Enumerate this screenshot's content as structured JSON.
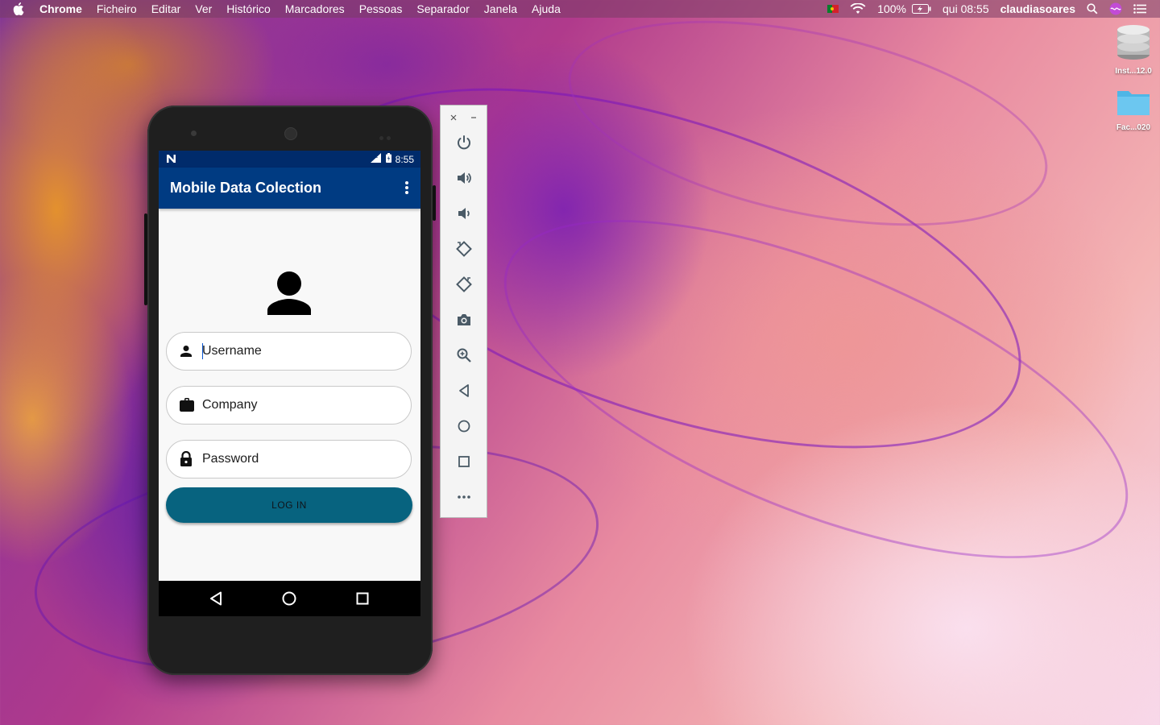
{
  "menubar": {
    "items": [
      "Chrome",
      "Ficheiro",
      "Editar",
      "Ver",
      "Histórico",
      "Marcadores",
      "Pessoas",
      "Separador",
      "Janela",
      "Ajuda"
    ],
    "battery": "100%",
    "clock": "qui 08:55",
    "user": "claudiasoares"
  },
  "desktop": {
    "icons": [
      {
        "label": "Inst...12.0",
        "icon": "disk-icon"
      },
      {
        "label": "Fac...020",
        "icon": "folder-icon"
      }
    ]
  },
  "phone": {
    "statusbar": {
      "time": "8:55"
    },
    "app_title": "Mobile Data Colection",
    "fields": {
      "username_placeholder": "Username",
      "company_placeholder": "Company",
      "password_placeholder": "Password"
    },
    "login_label": "LOG IN"
  },
  "emulator_toolbar": {
    "tools": [
      "power-icon",
      "volume-up-icon",
      "volume-down-icon",
      "rotate-left-icon",
      "rotate-right-icon",
      "camera-icon",
      "zoom-icon",
      "back-icon",
      "home-icon",
      "overview-icon",
      "more-icon"
    ]
  },
  "colors": {
    "appbar": "#003b82",
    "statusbar": "#002b6b",
    "login_button": "#07637f"
  }
}
